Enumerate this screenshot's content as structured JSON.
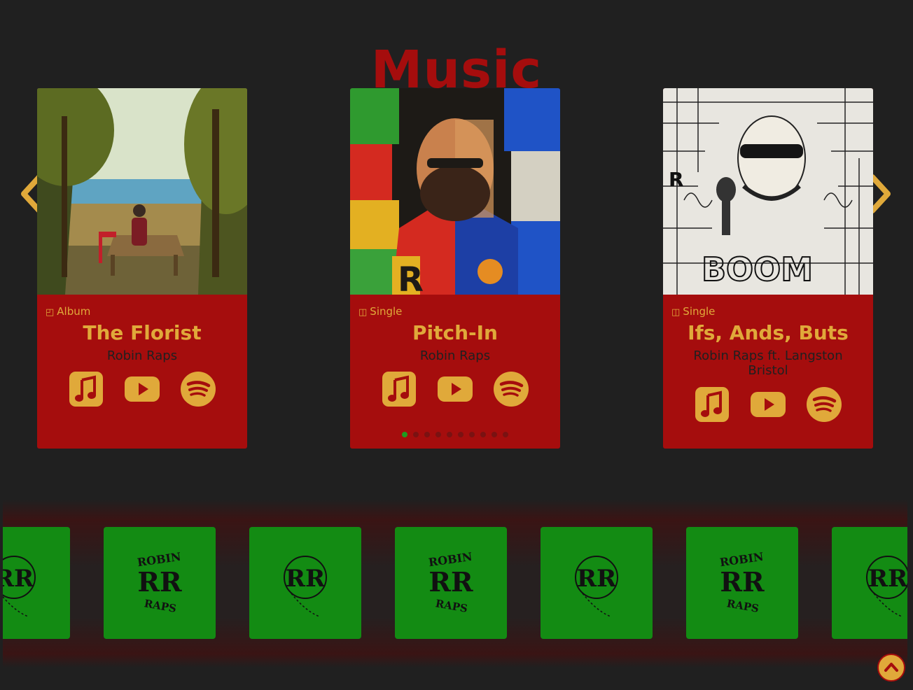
{
  "page": {
    "title": "Music"
  },
  "carousel": {
    "cards": [
      {
        "type_label": "Album",
        "title": "The Florist",
        "artist": "Robin Raps"
      },
      {
        "type_label": "Single",
        "title": "Pitch-In",
        "artist": "Robin Raps"
      },
      {
        "type_label": "Single",
        "title": "Ifs, Ands, Buts",
        "artist": "Robin Raps ft. Langston Bristol"
      }
    ],
    "link_icons": [
      "apple-music-icon",
      "youtube-icon",
      "spotify-icon"
    ],
    "dot_count": 10,
    "active_dot": 1
  },
  "logo_strip": {
    "tiles": [
      {
        "variant": "rr-balloon",
        "text": "RR"
      },
      {
        "variant": "robin-raps",
        "top": "ROBIN",
        "mid": "RR",
        "bot": "RAPS"
      },
      {
        "variant": "rr-balloon",
        "text": "RR"
      },
      {
        "variant": "robin-raps",
        "top": "ROBIN",
        "mid": "RR",
        "bot": "RAPS"
      },
      {
        "variant": "rr-balloon",
        "text": "RR"
      },
      {
        "variant": "robin-raps",
        "top": "ROBIN",
        "mid": "RR",
        "bot": "RAPS"
      },
      {
        "variant": "rr-balloon",
        "text": "RR"
      }
    ]
  },
  "colors": {
    "background": "#202020",
    "brand_red": "#a50d0d",
    "gold": "#e0a93a",
    "green": "#138b13"
  }
}
